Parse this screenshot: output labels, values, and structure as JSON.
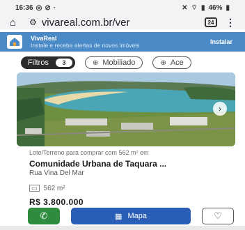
{
  "status_bar": {
    "time": "16:36",
    "battery": "46%"
  },
  "browser": {
    "url": "vivareal.com.br/ver",
    "tab_count": "24"
  },
  "app_banner": {
    "brand": "VivaReal",
    "description": "Instale e receba alertas de novos imóveis",
    "install_label": "Instalar"
  },
  "filters": {
    "main_label": "Filtros",
    "count": "3",
    "chips": [
      {
        "label": "Mobiliado",
        "icon": "plus-icon"
      },
      {
        "label": "Ace",
        "icon": "plus-icon"
      }
    ]
  },
  "listing": {
    "kind": "Lote/Terreno para comprar com 562 m² em",
    "title": "Comunidade Urbana de Taquara ...",
    "address": "Rua Vina Del Mar",
    "area": "562 m²",
    "price": "R$ 3.800.000",
    "map_label": "Mapa"
  },
  "colors": {
    "banner": "#4a8bc7",
    "whatsapp": "#2f8c3f",
    "map_button": "#2a5db5"
  }
}
